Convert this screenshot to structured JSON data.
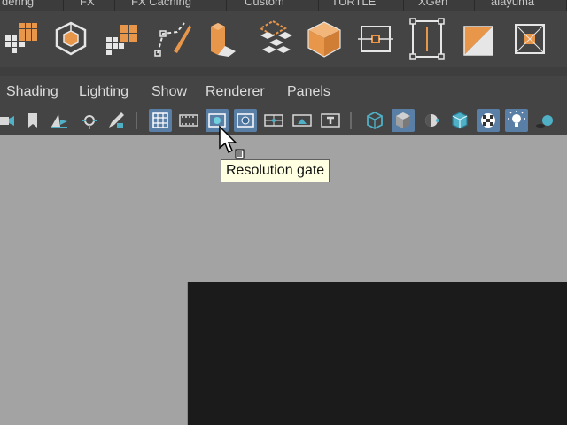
{
  "shelf_tabs": [
    "dering",
    "FX",
    "FX Caching",
    "Custom",
    "TURTLE",
    "XGen",
    "alayuma"
  ],
  "menubar": [
    "Shading",
    "Lighting",
    "Show",
    "Renderer",
    "Panels"
  ],
  "tooltip": "Resolution gate",
  "colors": {
    "accent_orange": "#e8964a",
    "active_blue": "#5a7fa6",
    "gate_border": "#3fb573",
    "viewport_bg": "#a3a3a3"
  },
  "shelf_icons": [
    "grid-cubes-icon",
    "wire-cube-icon",
    "grid-squares-icon",
    "curve-edit-icon",
    "extrude-icon",
    "tile-stack-icon",
    "solid-cube-icon",
    "center-pivot-icon",
    "bounding-box-icon",
    "split-square-icon",
    "snap-square-icon"
  ],
  "toolbar_icons": [
    "camera-icon",
    "bookmark-icon",
    "image-plane-icon",
    "pan-zoom-icon",
    "pencil-icon",
    "grid-icon",
    "film-gate-icon",
    "resolution-gate-icon",
    "gate-mask-icon",
    "field-chart-icon",
    "safe-action-icon",
    "safe-title-icon",
    "wireframe-icon",
    "smooth-shade-icon",
    "default-material-icon",
    "wireframe-on-shaded-icon",
    "xray-icon",
    "lighting-icon",
    "shadows-icon"
  ]
}
